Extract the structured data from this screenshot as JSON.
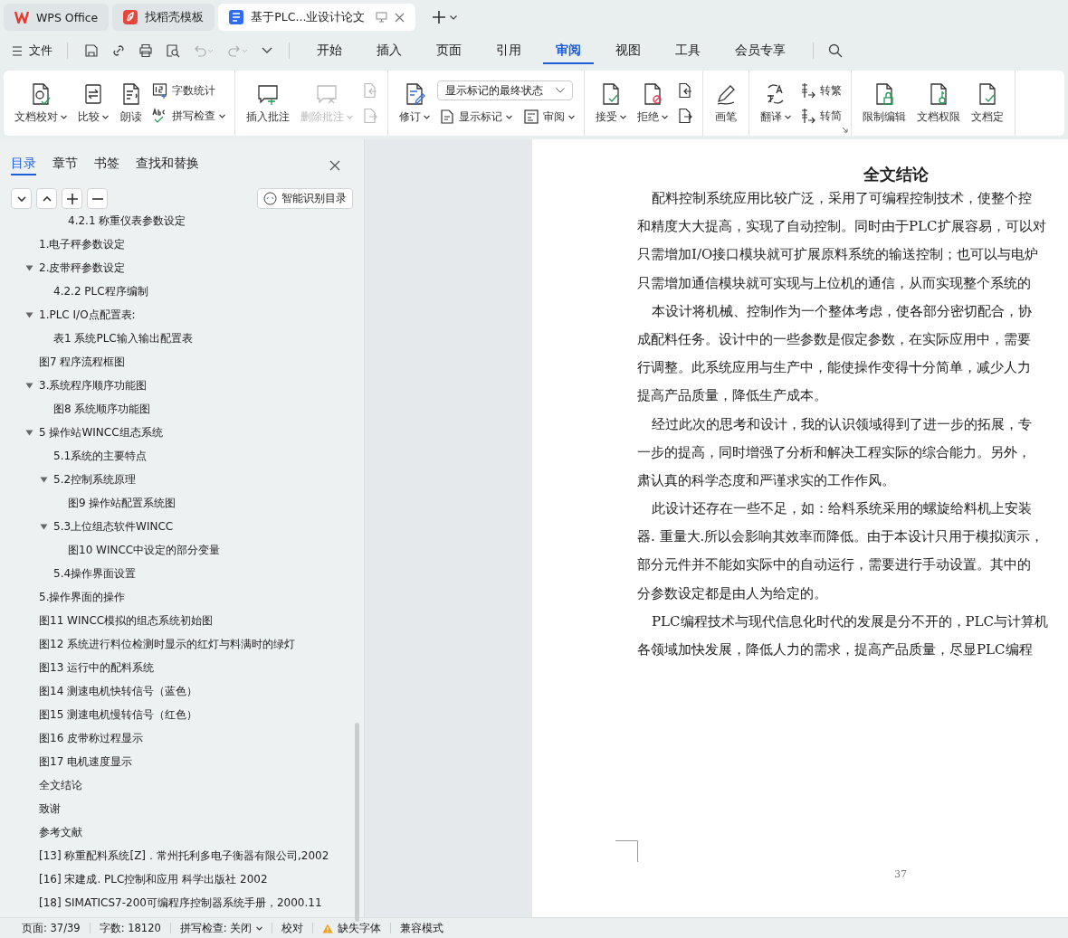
{
  "app_tabs": [
    {
      "label": "WPS Office",
      "selected": false
    },
    {
      "label": "找稻壳模板",
      "selected": false
    },
    {
      "label": "基于PLC...业设计论文",
      "selected": true
    }
  ],
  "menu": {
    "file": "文件",
    "tabs": [
      {
        "label": "开始",
        "selected": false
      },
      {
        "label": "插入",
        "selected": false
      },
      {
        "label": "页面",
        "selected": false
      },
      {
        "label": "引用",
        "selected": false
      },
      {
        "label": "审阅",
        "selected": true
      },
      {
        "label": "视图",
        "selected": false
      },
      {
        "label": "工具",
        "selected": false
      },
      {
        "label": "会员专享",
        "selected": false
      }
    ]
  },
  "ribbon": [
    {
      "items": [
        {
          "kind": "large",
          "label": "文档校对",
          "dropdown": true
        },
        {
          "kind": "large",
          "label": "比较",
          "dropdown": true
        },
        {
          "kind": "large",
          "label": "朗读",
          "dropdown": false
        },
        {
          "kind": "stack",
          "rows": [
            [
              {
                "label": "字数统计",
                "dropdown": false
              }
            ],
            [
              {
                "label": "拼写检查",
                "dropdown": true
              }
            ]
          ]
        }
      ]
    },
    {
      "items": [
        {
          "kind": "large",
          "label": "插入批注",
          "dropdown": false
        },
        {
          "kind": "large",
          "label": "删除批注",
          "dropdown": true,
          "disabled": true
        },
        {
          "kind": "stack",
          "rows": [
            [
              {
                "disabled": true
              }
            ],
            [
              {
                "disabled": true
              }
            ]
          ]
        }
      ]
    },
    {
      "items": [
        {
          "kind": "large",
          "label": "修订",
          "dropdown": true
        },
        {
          "kind": "stack",
          "rows": [
            [
              {
                "kind": "select",
                "value": "显示标记的最终状态"
              }
            ],
            [
              {
                "label": "显示标记",
                "dropdown": true
              },
              {
                "label": "审阅",
                "dropdown": true
              }
            ]
          ]
        }
      ]
    },
    {
      "items": [
        {
          "kind": "large",
          "label": "接受",
          "dropdown": true
        },
        {
          "kind": "large",
          "label": "拒绝",
          "dropdown": true
        },
        {
          "kind": "stack",
          "rows": [
            [
              {
                "disabled": false
              }
            ],
            [
              {
                "disabled": false
              }
            ]
          ]
        }
      ]
    },
    {
      "items": [
        {
          "kind": "large",
          "label": "画笔",
          "dropdown": false
        }
      ]
    },
    {
      "launcher": true,
      "items": [
        {
          "kind": "large",
          "label": "翻译",
          "dropdown": true
        },
        {
          "kind": "stack",
          "rows": [
            [
              {
                "label": "转繁",
                "dropdown": false
              }
            ],
            [
              {
                "label": "转简",
                "dropdown": false
              }
            ]
          ]
        }
      ]
    },
    {
      "items": [
        {
          "kind": "large",
          "label": "限制编辑",
          "dropdown": false
        },
        {
          "kind": "large",
          "label": "文档权限",
          "dropdown": false
        },
        {
          "kind": "large",
          "label": "文档定",
          "dropdown": false
        }
      ]
    }
  ],
  "sidebar": {
    "tabs": [
      {
        "label": "目录",
        "selected": true
      },
      {
        "label": "章节",
        "selected": false
      },
      {
        "label": "书签",
        "selected": false
      },
      {
        "label": "查找和替换",
        "selected": false
      }
    ],
    "smart_button": "智能识别目录",
    "toc": [
      {
        "children": [
          {
            "children": [
              {
                "label": "4.2.1 称重仪表参数设定"
              }
            ]
          }
        ]
      },
      {
        "label": "1.电子秤参数设定"
      },
      {
        "label": "2.皮带秤参数设定",
        "expanded": true,
        "children": [
          {
            "label": "4.2.2 PLC程序编制"
          }
        ]
      },
      {
        "label": "1.PLC I/O点配置表:",
        "expanded": true,
        "children": [
          {
            "label": "表1  系统PLC输入输出配置表"
          }
        ]
      },
      {
        "label": "图7  程序流程框图"
      },
      {
        "label": "3.系统程序顺序功能图",
        "expanded": true,
        "children": [
          {
            "label": "图8  系统顺序功能图"
          }
        ]
      },
      {
        "label": "5  操作站WINCC组态系统",
        "expanded": true,
        "children": [
          {
            "label": "5.1系统的主要特点"
          },
          {
            "label": "5.2控制系统原理",
            "expanded": true,
            "children": [
              {
                "label": "图9  操作站配置系统图"
              }
            ]
          },
          {
            "label": "5.3上位组态软件WINCC",
            "expanded": true,
            "children": [
              {
                "label": "图10 WINCC中设定的部分变量"
              }
            ]
          },
          {
            "label": "5.4操作界面设置"
          }
        ]
      },
      {
        "label": "5.操作界面的操作"
      },
      {
        "label": "图11 WINCC模拟的组态系统初始图"
      },
      {
        "label": "图12  系统进行料位检测时显示的红灯与料满时的绿灯"
      },
      {
        "label": "图13  运行中的配料系统"
      },
      {
        "label": "图14  测速电机快转信号（蓝色）"
      },
      {
        "label": "图15  测速电机慢转信号（红色）"
      },
      {
        "label": "图16  皮带称过程显示"
      },
      {
        "label": "图17  电机速度显示"
      },
      {
        "label": "全文结论"
      },
      {
        "label": "致谢"
      },
      {
        "label": "参考文献"
      },
      {
        "label": "[13]  称重配料系统[Z]．常州托利多电子衡器有限公司,2002"
      },
      {
        "label": "[16]  宋建成. PLC控制和应用  科学出版社  2002"
      },
      {
        "label": "[18] SIMATICS7-200可编程序控制器系统手册，2000.11"
      }
    ]
  },
  "document": {
    "heading": "全文结论",
    "paragraphs": [
      [
        "配料控制系统应用比较广泛，采用了可编程控制技术，使整个控",
        "和精度大大提高，实现了自动控制。同时由于PLC扩展容易，可以对",
        "只需增加I/O接口模块就可扩展原料系统的输送控制；也可以与电炉",
        "只需增加通信模块就可实现与上位机的通信，从而实现整个系统的"
      ],
      [
        "本设计将机械、控制作为一个整体考虑，使各部分密切配合，协",
        "成配料任务。设计中的一些参数是假定参数，在实际应用中，需要",
        "行调整。此系统应用与生产中，能使操作变得十分简单，减少人力",
        "提高产品质量，降低生产成本。"
      ],
      [
        "经过此次的思考和设计，我的认识领域得到了进一步的拓展，专",
        "一步的提高，同时增强了分析和解决工程实际的综合能力。另外，",
        "肃认真的科学态度和严谨求实的工作作风。"
      ],
      [
        "此设计还存在一些不足，如：给料系统采用的螺旋给料机上安装",
        "器. 重量大.所以会影响其效率而降低。由于本设计只用于模拟演示，",
        "部分元件并不能如实际中的自动运行，需要进行手动设置。其中的",
        "分参数设定都是由人为给定的。"
      ],
      [
        "PLC编程技术与现代信息化时代的发展是分不开的，PLC与计算机",
        "各领域加快发展，降低人力的需求，提高产品质量，尽显PLC编程"
      ]
    ],
    "page_number": "37"
  },
  "status_bar": [
    {
      "kind": "text",
      "label": "页面: 37/39"
    },
    {
      "kind": "text",
      "label": "字数: 18120"
    },
    {
      "kind": "dropdown",
      "label": "拼写检查: 关闭"
    },
    {
      "kind": "button",
      "label": "校对"
    },
    {
      "kind": "warning",
      "label": "缺失字体"
    },
    {
      "kind": "text",
      "label": "兼容模式"
    }
  ]
}
